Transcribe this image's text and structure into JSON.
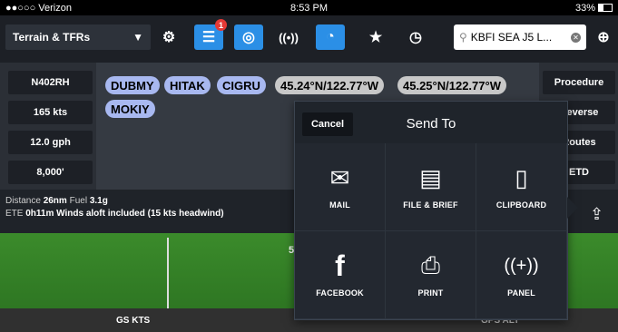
{
  "status": {
    "carrier": "●●○○○ Verizon",
    "time": "8:53 PM",
    "battery": "33%"
  },
  "toolbar": {
    "layer_label": "Terrain & TFRs",
    "notification_count": "1",
    "search_text": "KBFI SEA J5 L...",
    "icons": [
      "chevron-down-icon",
      "gear-icon",
      "list-icon",
      "globe-icon",
      "broadcast-icon",
      "timer-icon",
      "star-icon",
      "clock-icon",
      "search-icon",
      "clear-icon",
      "crosshair-icon"
    ]
  },
  "aircraft": {
    "tail": "N402RH",
    "speed": "165 kts",
    "fuel_burn": "12.0 gph",
    "altitude": "8,000'"
  },
  "route": {
    "waypoints": [
      "DUBMY",
      "HITAK",
      "CIGRU",
      "MOKIY"
    ],
    "coords": [
      "45.24°N/122.77°W",
      "45.25°N/122.77°W"
    ]
  },
  "right_buttons": [
    "Procedure",
    "Reverse",
    "Routes",
    "ETD"
  ],
  "info": {
    "distance_label": "Distance",
    "distance": "26nm",
    "fuel_label": "Fuel",
    "fuel": "3.1g",
    "ete_label": "ETE",
    "ete": "0h11m",
    "winds": "Winds aloft included (15 kts headwind)"
  },
  "map": {
    "gs_label": "GS KTS",
    "gps_label": "GPS ALT",
    "tape_value": "5"
  },
  "send_to": {
    "cancel_label": "Cancel",
    "title": "Send To",
    "options": [
      {
        "label": "MAIL",
        "icon": "mail-icon"
      },
      {
        "label": "FILE & BRIEF",
        "icon": "file-brief-icon"
      },
      {
        "label": "CLIPBOARD",
        "icon": "clipboard-icon"
      },
      {
        "label": "FACEBOOK",
        "icon": "facebook-icon"
      },
      {
        "label": "PRINT",
        "icon": "printer-icon"
      },
      {
        "label": "PANEL",
        "icon": "panel-icon"
      }
    ]
  }
}
